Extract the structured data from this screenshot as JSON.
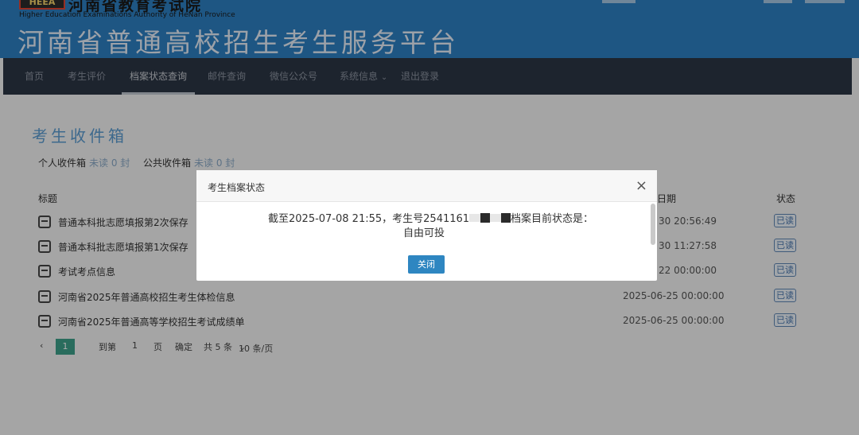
{
  "header": {
    "logo_badge": "HEEA",
    "logo_cn": "河南省教育考试院",
    "logo_en": "Higher Education Examinations Authority of HeNan Province",
    "site_title": "河南省普通高校招生考生服务平台"
  },
  "nav": {
    "items": [
      {
        "label": "首页"
      },
      {
        "label": "考生评价"
      },
      {
        "label": "档案状态查询"
      },
      {
        "label": "邮件查询"
      },
      {
        "label": "微信公众号"
      },
      {
        "label": "系统信息"
      },
      {
        "label": "退出登录"
      }
    ],
    "active": "档案状态查询"
  },
  "inbox": {
    "title": "考生收件箱",
    "personal_tab": "个人收件箱",
    "personal_unread": "未读 0 封",
    "public_tab": "公共收件箱",
    "public_unread": "未读 0 封",
    "columns": {
      "title": "标题",
      "date": "日期",
      "status": "状态"
    },
    "rows": [
      {
        "title": "普通本科批志愿填报第2次保存",
        "date": "30 20:56:49",
        "status": "已读"
      },
      {
        "title": "普通本科批志愿填报第1次保存",
        "date": "30 11:27:58",
        "status": "已读"
      },
      {
        "title": "考试考点信息",
        "date": "22 00:00:00",
        "status": "已读"
      },
      {
        "title": "河南省2025年普通高校招生考生体检信息",
        "date": "2025-06-25 00:00:00",
        "status": "已读"
      },
      {
        "title": "河南省2025年普通高等学校招生考试成绩单",
        "date": "2025-06-25 00:00:00",
        "status": "已读"
      }
    ]
  },
  "pager": {
    "current": "1",
    "goto_label": "到第",
    "goto_value": "1",
    "page_unit": "页",
    "confirm": "确定",
    "total": "共 5 条",
    "page_size": "10 条/页"
  },
  "modal": {
    "title": "考生档案状态",
    "close_symbol": "×",
    "msg_prefix": "截至2025-07-08 21:55，考生号2541161",
    "msg_suffix": "档案目前状态是：",
    "status_value": "自由可投",
    "button_label": "关闭"
  }
}
